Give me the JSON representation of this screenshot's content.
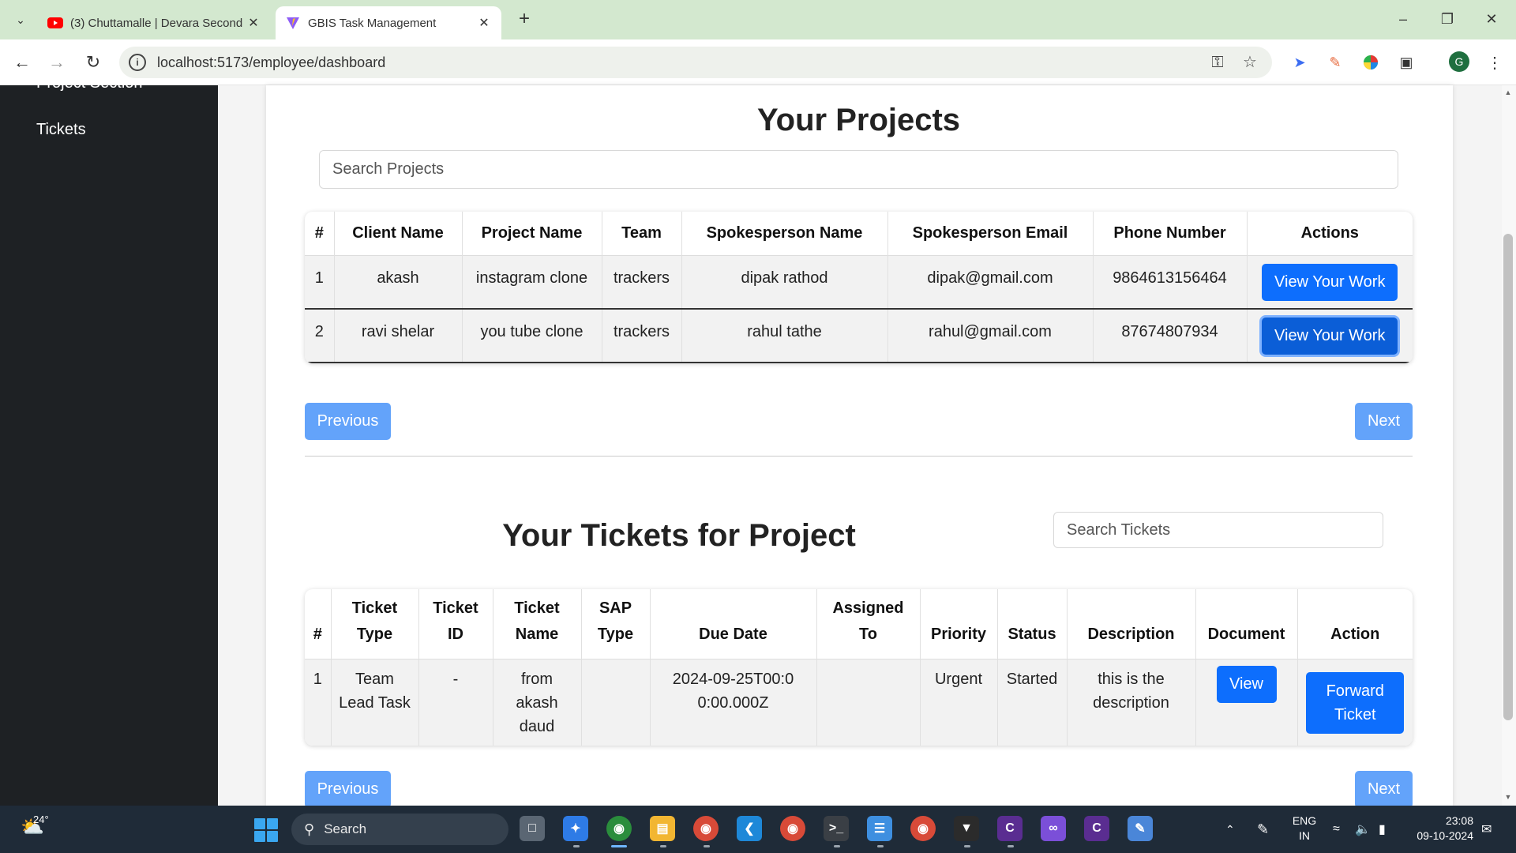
{
  "browser": {
    "tabs": [
      {
        "title": "(3) Chuttamalle | Devara Second",
        "icon": "youtube-icon",
        "active": false
      },
      {
        "title": "GBIS Task Management",
        "icon": "vite-icon",
        "active": true
      }
    ],
    "new_tab": "+",
    "url": "localhost:5173/employee/dashboard",
    "profile_initial": "G"
  },
  "sidebar": {
    "items": [
      {
        "label": "Project Section"
      },
      {
        "label": "Tickets"
      }
    ]
  },
  "projects": {
    "title": "Your Projects",
    "search_placeholder": "Search Projects",
    "columns": [
      "#",
      "Client Name",
      "Project Name",
      "Team",
      "Spokesperson Name",
      "Spokesperson Email",
      "Phone Number",
      "Actions"
    ],
    "rows": [
      {
        "num": "1",
        "client": "akash",
        "project": "instagram clone",
        "team": "trackers",
        "spokesperson": "dipak rathod",
        "email": "dipak@gmail.com",
        "phone": "9864613156464",
        "action": "View Your Work"
      },
      {
        "num": "2",
        "client": "ravi shelar",
        "project": "you tube clone",
        "team": "trackers",
        "spokesperson": "rahul tathe",
        "email": "rahul@gmail.com",
        "phone": "87674807934",
        "action": "View Your Work"
      }
    ],
    "prev_label": "Previous",
    "next_label": "Next"
  },
  "tickets": {
    "title": "Your Tickets for Project",
    "search_placeholder": "Search Tickets",
    "columns": [
      "#",
      "Ticket Type",
      "Ticket ID",
      "Ticket Name",
      "SAP Type",
      "Due Date",
      "Assigned To",
      "Priority",
      "Status",
      "Description",
      "Document",
      "Action"
    ],
    "rows": [
      {
        "num": "1",
        "type": "Team Lead Task",
        "id": "-",
        "name": "from akash daud",
        "sap": "",
        "due": "2024-09-25T00:00:00.000Z",
        "assigned": "",
        "priority": "Urgent",
        "status": "Started",
        "description": "this is the description",
        "document": "View",
        "action": "Forward Ticket"
      }
    ],
    "prev_label": "Previous",
    "next_label": "Next"
  },
  "taskbar": {
    "weather": "24°",
    "search_label": "Search",
    "lang_line1": "ENG",
    "lang_line2": "IN",
    "time": "23:08",
    "date": "09-10-2024"
  }
}
